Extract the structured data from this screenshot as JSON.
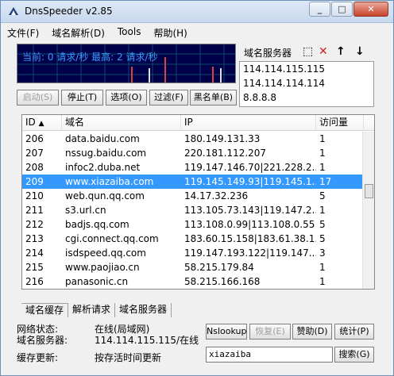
{
  "titlebar": {
    "title": "DnsSpeeder v2.85"
  },
  "menubar": {
    "items": [
      "文件(F)",
      "域名解析(D)",
      "Tools",
      "帮助(H)"
    ]
  },
  "graph": {
    "text": "当前: 0 请求/秒 最高: 2 请求/秒"
  },
  "toolbar": {
    "start": "启动(S)",
    "stop": "停止(T)",
    "options": "选项(O)",
    "filter": "过滤(F)",
    "blacklist": "黑名单(B)"
  },
  "servers": {
    "title": "域名服务器",
    "items": [
      "114.114.115.115",
      "114.114.114.114",
      "8.8.8.8"
    ]
  },
  "table": {
    "headers": [
      "ID",
      "域名",
      "IP",
      "访问量"
    ],
    "rows": [
      {
        "id": "206",
        "domain": "data.baidu.com",
        "ip": "180.149.131.33",
        "count": "1"
      },
      {
        "id": "207",
        "domain": "nssug.baidu.com",
        "ip": "220.181.112.207",
        "count": "1"
      },
      {
        "id": "208",
        "domain": "infoc2.duba.net",
        "ip": "119.147.146.70|221.228.2...",
        "count": "1"
      },
      {
        "id": "209",
        "domain": "www.xiazaiba.com",
        "ip": "119.145.149.93|119.145.1...",
        "count": "17",
        "selected": true
      },
      {
        "id": "210",
        "domain": "web.qun.qq.com",
        "ip": "14.17.32.236",
        "count": "5"
      },
      {
        "id": "211",
        "domain": "s3.url.cn",
        "ip": "113.105.73.143|119.147.2...",
        "count": "1"
      },
      {
        "id": "212",
        "domain": "badjs.qq.com",
        "ip": "113.108.0.99|113.108.0.55",
        "count": "5"
      },
      {
        "id": "213",
        "domain": "cgi.connect.qq.com",
        "ip": "183.60.15.158|183.61.38.1...",
        "count": "5"
      },
      {
        "id": "214",
        "domain": "isdspeed.qq.com",
        "ip": "119.147.193.122|119.147....",
        "count": "3"
      },
      {
        "id": "215",
        "domain": "www.paojiao.cn",
        "ip": "58.215.179.84",
        "count": "1"
      },
      {
        "id": "216",
        "domain": "panasonic.cn",
        "ip": "58.215.166.168",
        "count": "1"
      }
    ]
  },
  "tabs": [
    "域名缓存",
    "解析请求",
    "域名服务器"
  ],
  "status": {
    "net_label": "网络状态:",
    "net_value": "在线(局域网)",
    "server_label": "域名服务器:",
    "server_value": "114.114.115.115/在线",
    "update_label": "缓存更新:",
    "update_value": "按存活时间更新"
  },
  "actions": {
    "nslookup": "Nslookup",
    "restore": "恢复(E)",
    "sponsor": "赞助(D)",
    "stats": "统计(P)",
    "search": "搜索(G)"
  },
  "search": {
    "value": "xiazaiba"
  }
}
